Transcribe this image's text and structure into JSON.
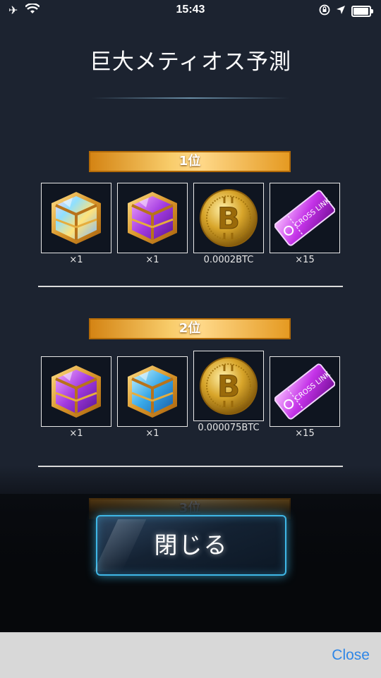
{
  "status_bar": {
    "time": "15:43"
  },
  "dialog": {
    "title": "巨大メティオス予測",
    "ranks": [
      {
        "label": "1位",
        "rewards": [
          {
            "icon": "gold-cube-icon",
            "qty": "×1"
          },
          {
            "icon": "purple-cube-icon",
            "qty": "×1"
          },
          {
            "icon": "bitcoin-icon",
            "qty": "0.0002BTC"
          },
          {
            "icon": "cross-link-ticket-icon",
            "qty": "×15"
          }
        ]
      },
      {
        "label": "2位",
        "rewards": [
          {
            "icon": "purple-cube-icon",
            "qty": "×1"
          },
          {
            "icon": "blue-cube-icon",
            "qty": "×1"
          },
          {
            "icon": "bitcoin-icon",
            "qty": "0.000075BTC"
          },
          {
            "icon": "cross-link-ticket-icon",
            "qty": "×15"
          }
        ]
      },
      {
        "label": "3位"
      }
    ],
    "close_button": "閉じる"
  },
  "webview": {
    "close_link": "Close"
  },
  "colors": {
    "rank_bar": "#f5b53a",
    "button_glow": "#3fb7e6",
    "close_link": "#2f86e6",
    "panel": "#1c2330"
  }
}
